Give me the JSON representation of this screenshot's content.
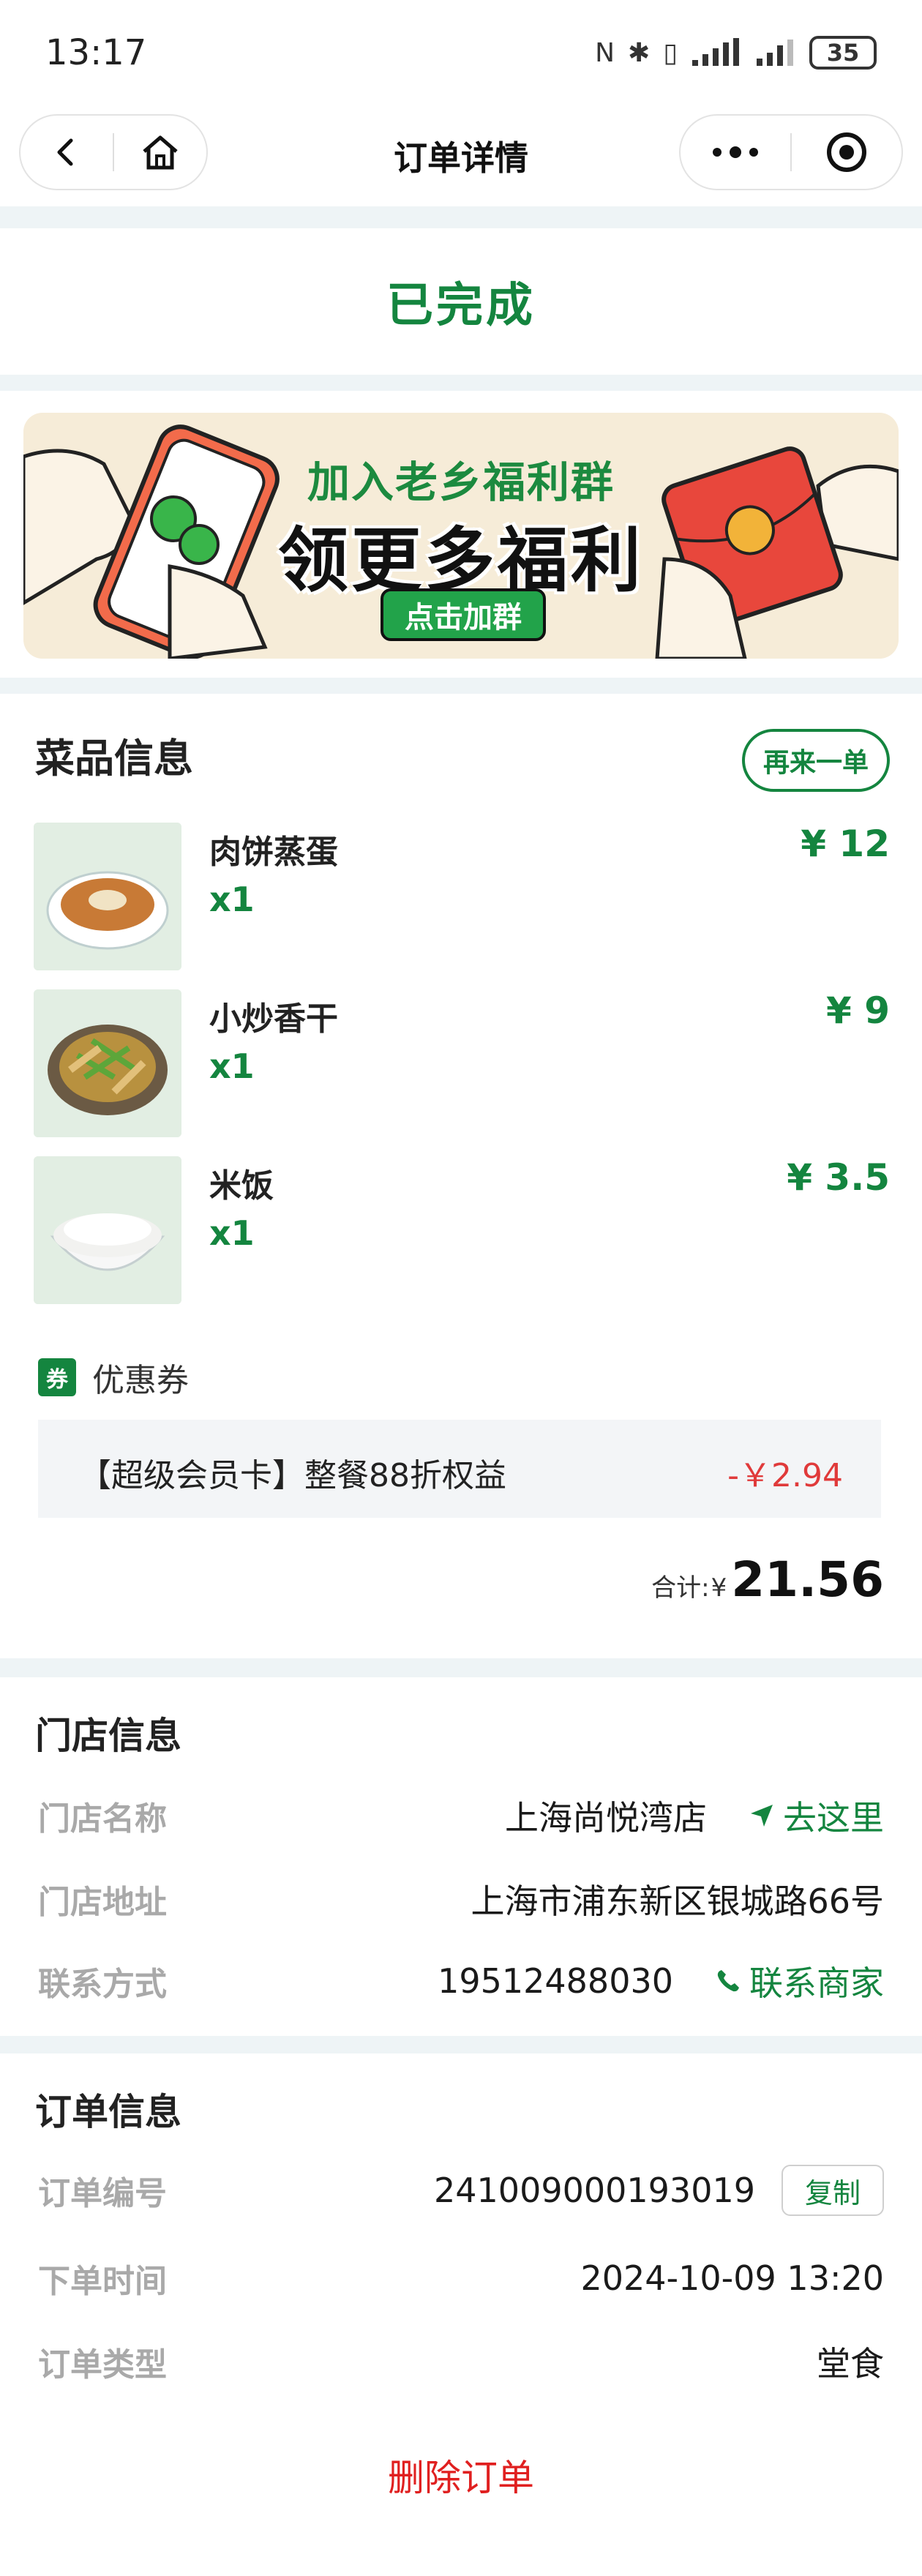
{
  "status_bar": {
    "time": "13:17",
    "battery": "35"
  },
  "nav": {
    "title": "订单详情"
  },
  "order_status": "已完成",
  "banner": {
    "line1": "加入老乡福利群",
    "line2": "领更多福利",
    "button": "点击加群"
  },
  "dishes": {
    "title": "菜品信息",
    "reorder_label": "再来一单",
    "items": [
      {
        "name": "肉饼蒸蛋",
        "qty": "x1",
        "price": "¥ 12"
      },
      {
        "name": "小炒香干",
        "qty": "x1",
        "price": "¥ 9"
      },
      {
        "name": "米饭",
        "qty": "x1",
        "price": "¥ 3.5"
      }
    ],
    "coupon": {
      "icon_text": "券",
      "label": "优惠券",
      "name": "【超级会员卡】整餐88折权益",
      "discount": "-￥2.94"
    },
    "total": {
      "label": "合计:",
      "currency": "¥",
      "value": "21.56"
    }
  },
  "store": {
    "title": "门店信息",
    "rows": [
      {
        "key": "门店名称",
        "value": "上海尚悦湾店",
        "action": "去这里"
      },
      {
        "key": "门店地址",
        "value": "上海市浦东新区银城路66号"
      },
      {
        "key": "联系方式",
        "value": "19512488030",
        "action": "联系商家"
      }
    ]
  },
  "order": {
    "title": "订单信息",
    "rows": [
      {
        "key": "订单编号",
        "value": "241009000193019",
        "action": "复制"
      },
      {
        "key": "下单时间",
        "value": "2024-10-09 13:20"
      },
      {
        "key": "订单类型",
        "value": "堂食"
      }
    ],
    "delete_label": "删除订单"
  },
  "colors": {
    "accent_green": "#14853f",
    "danger_red": "#e02020",
    "discount_red": "#e03a3a"
  }
}
